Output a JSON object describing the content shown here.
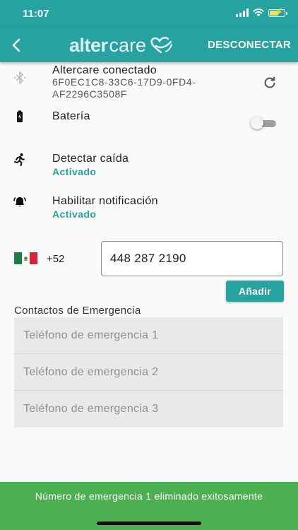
{
  "status_bar": {
    "time": "11:07"
  },
  "app_bar": {
    "logo_left": "alter",
    "logo_right": "care",
    "disconnect_label": "DESCONECTAR"
  },
  "device": {
    "title": "Altercare conectado",
    "id_line1": "6F0EC1C8-33C6-17D9-0FD4-",
    "id_line2": "AF2296C3508F"
  },
  "battery": {
    "title": "Batería",
    "toggle_on": false
  },
  "fall_detection": {
    "title": "Detectar caída",
    "status": "Activado"
  },
  "notifications": {
    "title": "Habilitar notificación",
    "status": "Activado"
  },
  "phone": {
    "country_code": "+52",
    "value": "448 287 2190",
    "add_label": "Añadir"
  },
  "emergency": {
    "label": "Contactos de Emergencia",
    "fields": [
      {
        "placeholder": "Teléfono de emergencia 1"
      },
      {
        "placeholder": "Teléfono de emergencia 2"
      },
      {
        "placeholder": "Teléfono de emergencia 3"
      }
    ]
  },
  "snackbar": {
    "message": "Número de emergencia 1 eliminado exitosamente"
  },
  "colors": {
    "primary": "#26a3a0",
    "success": "#4caf50",
    "flag_green": "#1e7d43",
    "flag_white": "#ffffff",
    "flag_red": "#d9233b"
  },
  "icons": {
    "bluetooth": "bluetooth-icon",
    "refresh": "refresh-icon",
    "battery": "battery-charging-icon",
    "fall": "running-person-icon",
    "notification": "bell-ring-icon",
    "flag": "mexico-flag-icon",
    "back": "chevron-left-icon"
  }
}
